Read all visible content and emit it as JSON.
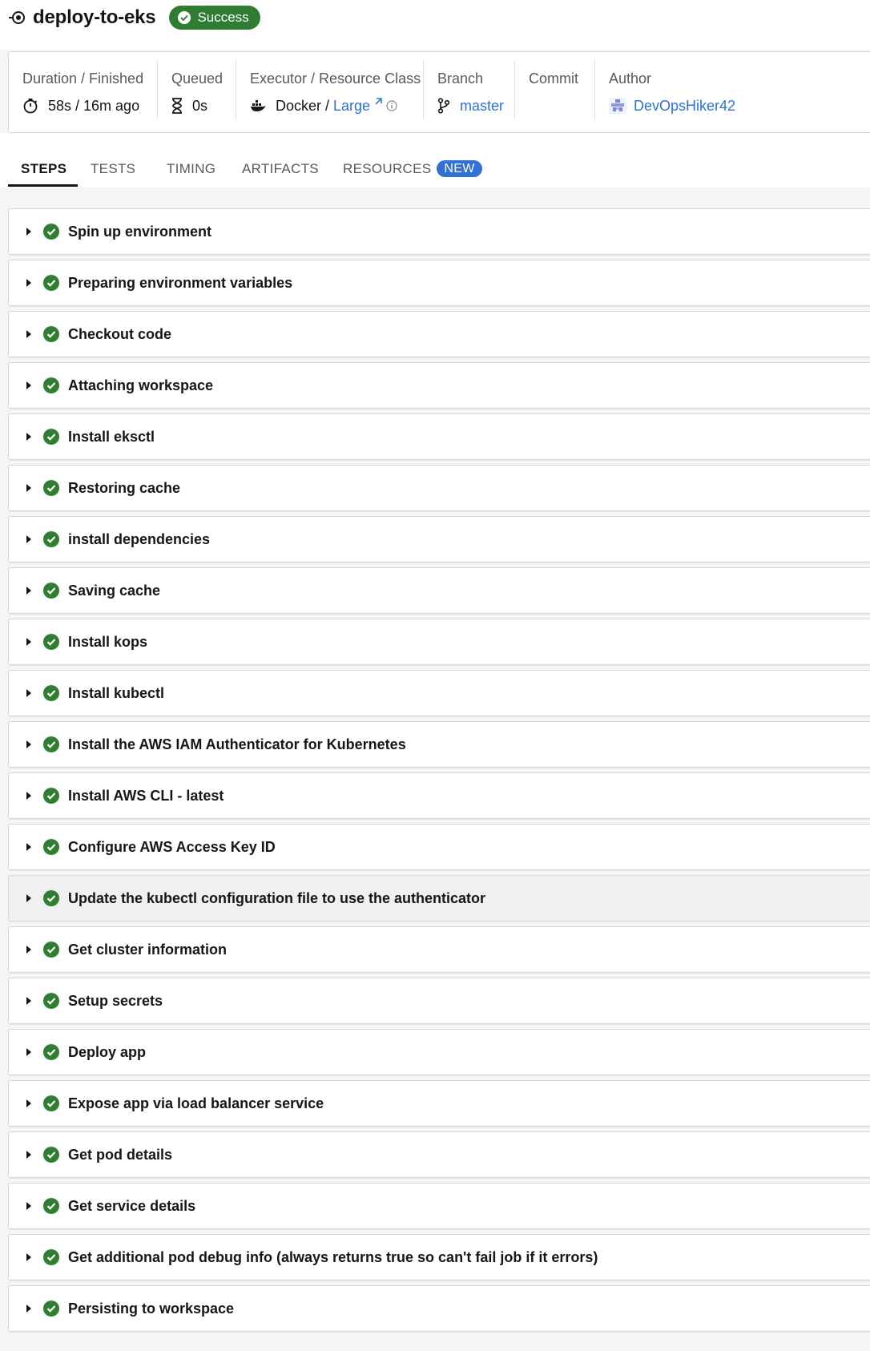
{
  "header": {
    "job_name": "deploy-to-eks",
    "status": "Success"
  },
  "meta": {
    "duration": {
      "label": "Duration / Finished",
      "value": "58s / 16m ago"
    },
    "queued": {
      "label": "Queued",
      "value": "0s"
    },
    "executor": {
      "label": "Executor / Resource Class",
      "executor": "Docker",
      "separator": " / ",
      "resource_class": "Large"
    },
    "branch": {
      "label": "Branch",
      "value": "master"
    },
    "commit": {
      "label": "Commit",
      "value": ""
    },
    "author": {
      "label": "Author",
      "value": "DevOpsHiker42"
    }
  },
  "tabs": [
    {
      "label": "STEPS",
      "active": true
    },
    {
      "label": "TESTS"
    },
    {
      "label": "TIMING"
    },
    {
      "label": "ARTIFACTS"
    },
    {
      "label": "RESOURCES",
      "badge": "NEW"
    }
  ],
  "steps": [
    {
      "label": "Spin up environment",
      "status": "success"
    },
    {
      "label": "Preparing environment variables",
      "status": "success"
    },
    {
      "label": "Checkout code",
      "status": "success"
    },
    {
      "label": "Attaching workspace",
      "status": "success"
    },
    {
      "label": "Install eksctl",
      "status": "success"
    },
    {
      "label": "Restoring cache",
      "status": "success"
    },
    {
      "label": "install dependencies",
      "status": "success"
    },
    {
      "label": "Saving cache",
      "status": "success"
    },
    {
      "label": "Install kops",
      "status": "success"
    },
    {
      "label": "Install kubectl",
      "status": "success"
    },
    {
      "label": "Install the AWS IAM Authenticator for Kubernetes",
      "status": "success"
    },
    {
      "label": "Install AWS CLI - latest",
      "status": "success"
    },
    {
      "label": "Configure AWS Access Key ID",
      "status": "success"
    },
    {
      "label": "Update the kubectl configuration file to use the authenticator",
      "status": "success",
      "hovered": true
    },
    {
      "label": "Get cluster information",
      "status": "success"
    },
    {
      "label": "Setup secrets",
      "status": "success"
    },
    {
      "label": "Deploy app",
      "status": "success"
    },
    {
      "label": "Expose app via load balancer service",
      "status": "success"
    },
    {
      "label": "Get pod details",
      "status": "success"
    },
    {
      "label": "Get service details",
      "status": "success"
    },
    {
      "label": "Get additional pod debug info (always returns true so can't fail job if it errors)",
      "status": "success"
    },
    {
      "label": "Persisting to workspace",
      "status": "success"
    }
  ],
  "colors": {
    "success": "#2e7d32",
    "link": "#2f71d4",
    "badge_new": "#2f71d4"
  },
  "icons": {
    "job": "job-workflow-icon",
    "status": "check-circle-icon",
    "duration": "stopwatch-icon",
    "queued": "hourglass-icon",
    "executor": "docker-icon",
    "branch": "git-branch-icon",
    "author": "avatar-icon",
    "step_status": "check-circle-icon",
    "step_toggle": "caret-right-icon"
  }
}
